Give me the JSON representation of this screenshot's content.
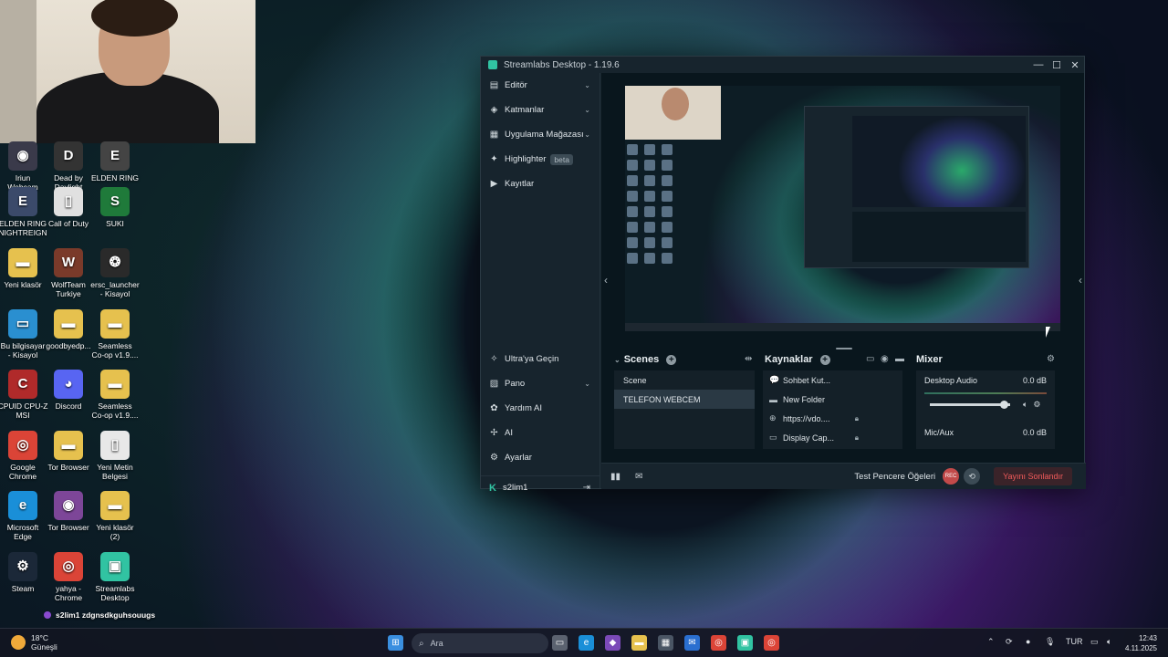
{
  "desktop": {
    "icons": [
      {
        "label": "Iriun\nWebcam",
        "color": "#3a3a4a",
        "glyph": "◉"
      },
      {
        "label": "Dead by\nDaylight",
        "color": "#333",
        "glyph": "D"
      },
      {
        "label": "ELDEN RING",
        "color": "#444",
        "glyph": "E"
      },
      {
        "label": "ELDEN RING\nNIGHTREIGN",
        "color": "#3b4a6a",
        "glyph": "E"
      },
      {
        "label": "Call of Duty",
        "color": "#e0e0e0",
        "glyph": "▯"
      },
      {
        "label": "SUKI",
        "color": "#1f7a3a",
        "glyph": "S"
      },
      {
        "label": "Yeni klasör",
        "color": "#e6c14e",
        "glyph": "▬"
      },
      {
        "label": "WolfTeam\nTurkiye",
        "color": "#7a3a2a",
        "glyph": "W"
      },
      {
        "label": "ersc_launcher\n- Kisayol",
        "color": "#2a2a2a",
        "glyph": "❂"
      },
      {
        "label": "Bu bilgisayar\n- Kisayol",
        "color": "#2a8fd0",
        "glyph": "▭"
      },
      {
        "label": "goodbyedp...",
        "color": "#e6c14e",
        "glyph": "▬"
      },
      {
        "label": "Seamless\nCo-op v1.9....",
        "color": "#e6c14e",
        "glyph": "▬"
      },
      {
        "label": "CPUID CPU-Z\nMSI",
        "color": "#b02a2a",
        "glyph": "C"
      },
      {
        "label": "Discord",
        "color": "#5865f2",
        "glyph": "◕"
      },
      {
        "label": "Seamless\nCo-op v1.9....",
        "color": "#e6c14e",
        "glyph": "▬"
      },
      {
        "label": "Google\nChrome",
        "color": "#db4437",
        "glyph": "◎"
      },
      {
        "label": "Tor Browser",
        "color": "#e6c14e",
        "glyph": "▬"
      },
      {
        "label": "Yeni Metin\nBelgesi",
        "color": "#e8e8e8",
        "glyph": "▯"
      },
      {
        "label": "Microsoft\nEdge",
        "color": "#1a8fd8",
        "glyph": "e"
      },
      {
        "label": "Tor Browser",
        "color": "#7d4698",
        "glyph": "◉"
      },
      {
        "label": "Yeni klasör\n(2)",
        "color": "#e6c14e",
        "glyph": "▬"
      },
      {
        "label": "Steam",
        "color": "#1b2838",
        "glyph": "⚙"
      },
      {
        "label": "yahya -\nChrome",
        "color": "#db4437",
        "glyph": "◎"
      },
      {
        "label": "Streamlabs\nDesktop",
        "color": "#31c3a2",
        "glyph": "▣"
      }
    ],
    "stream_tag": "s2lim1  zdgnsdkguhsouugs"
  },
  "window": {
    "title": "Streamlabs Desktop - 1.19.6",
    "controls": [
      "—",
      "☐",
      "✕"
    ],
    "nav": [
      {
        "label": "Editör",
        "icon": "editor-icon",
        "glyph": "▤",
        "chevron": true
      },
      {
        "label": "Katmanlar",
        "icon": "layers-icon",
        "glyph": "◈",
        "chevron": true
      },
      {
        "label": "Uygulama Mağazası",
        "icon": "store-icon",
        "glyph": "▦",
        "chevron": true
      },
      {
        "label": "Highlighter",
        "icon": "highlighter-icon",
        "glyph": "✦",
        "chevron": false,
        "badge": "beta"
      },
      {
        "label": "Kayıtlar",
        "icon": "recordings-icon",
        "glyph": "▶",
        "chevron": false
      }
    ],
    "bottom_nav": [
      {
        "label": "Ultra'ya Geçin",
        "icon": "ultra-icon",
        "glyph": "✧",
        "chevron": false
      },
      {
        "label": "Pano",
        "icon": "dashboard-icon",
        "glyph": "▨",
        "chevron": true
      },
      {
        "label": "Yardım AI",
        "icon": "help-ai-icon",
        "glyph": "✿",
        "chevron": false
      },
      {
        "label": "AI",
        "icon": "ai-icon",
        "glyph": "✢",
        "chevron": false
      },
      {
        "label": "Ayarlar",
        "icon": "settings-icon",
        "glyph": "⚙",
        "chevron": false
      }
    ],
    "user": {
      "name": "s2lim1"
    },
    "scenes": {
      "title": "Scenes",
      "items": [
        "Scene",
        "TELEFON WEBCEM"
      ],
      "active_index": 1
    },
    "sources": {
      "title": "Kaynaklar",
      "items": [
        {
          "label": "Sohbet Kut...",
          "glyph": "💬",
          "lock": false
        },
        {
          "label": "New Folder",
          "glyph": "▬",
          "lock": false
        },
        {
          "label": "https://vdo....",
          "glyph": "⊕",
          "lock": true
        },
        {
          "label": "Display Cap...",
          "glyph": "▭",
          "lock": true
        }
      ]
    },
    "mixer": {
      "title": "Mixer",
      "channels": [
        {
          "name": "Desktop Audio",
          "level": "0.0 dB",
          "fader": 0.92
        },
        {
          "name": "Mic/Aux",
          "level": "0.0 dB"
        }
      ]
    },
    "footer": {
      "test_label": "Test Pencere Öğeleri",
      "rec_label": "REC",
      "end_label": "Yayını Sonlandır"
    }
  },
  "taskbar": {
    "weather_temp": "18°C",
    "weather_desc": "Güneşli",
    "search_placeholder": "Ara",
    "language": "TUR",
    "time": "12:43",
    "date": "4.11.2025"
  }
}
